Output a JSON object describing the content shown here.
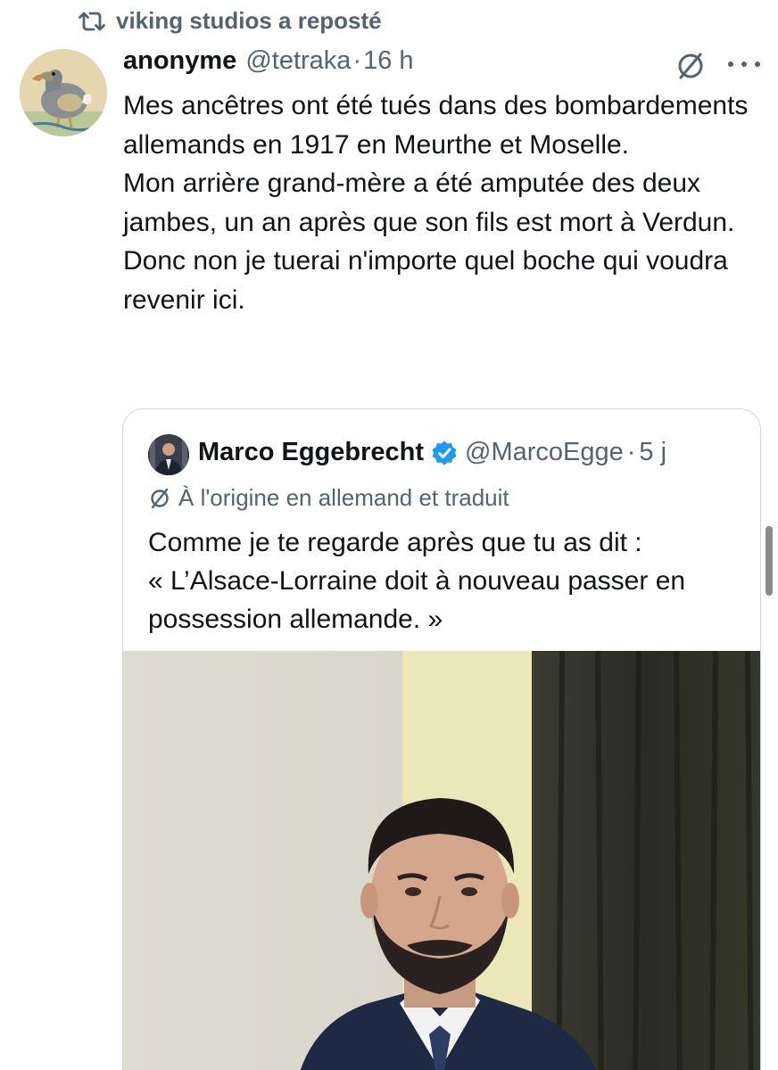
{
  "repost": {
    "icon": "repost-icon",
    "text": "viking studios a reposté"
  },
  "tweet": {
    "avatar_icon": "dodo-avatar",
    "display_name": "anonyme",
    "handle": "@tetraka",
    "separator": "·",
    "time": "16 h",
    "translate_icon": "translate-icon",
    "more_icon": "more-icon",
    "body": [
      "Mes ancêtres ont été tués dans des bombardements allemands en 1917 en Meurthe et Moselle.",
      "Mon arrière grand-mère a été amputée des deux jambes, un an après que son fils est mort à Verdun.",
      "Donc non je tuerai n'importe quel boche qui voudra revenir ici."
    ]
  },
  "quote": {
    "display_name": "Marco Eggebrecht",
    "verified_icon": "verified-badge-icon",
    "verified_color": "#1d9bf0",
    "handle": "@MarcoEgge",
    "separator": "·",
    "time": "5 j",
    "translated_label": "À l'origine en allemand et traduit",
    "body": [
      "Comme je te regarde après que tu as dit :",
      "« L’Alsace-Lorraine doit à nouveau passer en possession allemande. »"
    ],
    "media_icon": "photo-man-in-suit"
  },
  "colors": {
    "text_primary": "#0f1419",
    "text_secondary": "#536471",
    "border": "#cfd9de"
  }
}
